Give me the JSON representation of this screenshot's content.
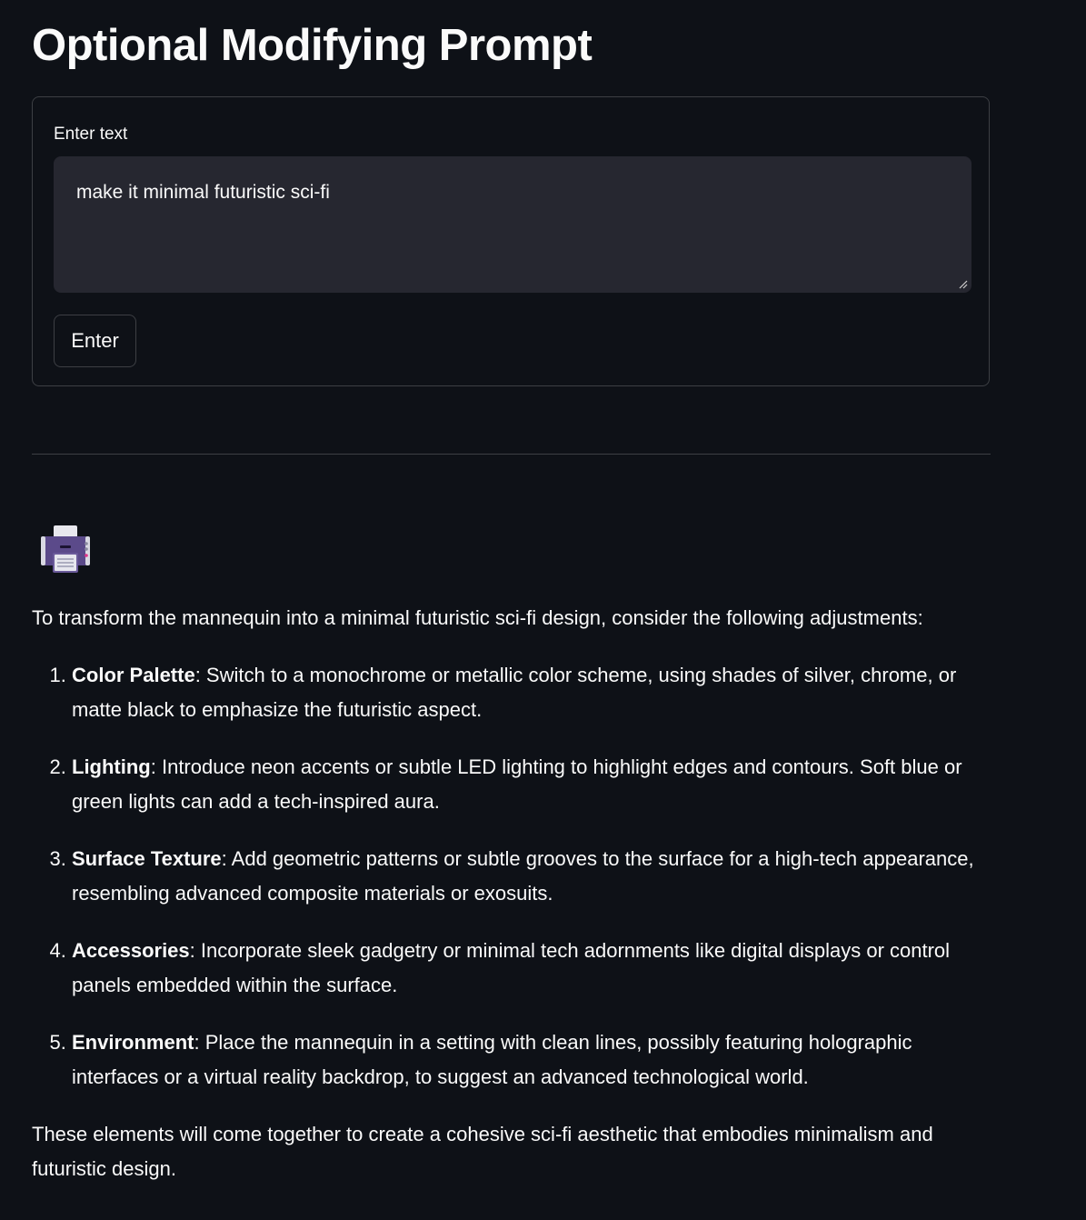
{
  "page": {
    "title": "Optional Modifying Prompt"
  },
  "form": {
    "field_label": "Enter text",
    "text_value": "make it minimal futuristic sci-fi",
    "submit_label": "Enter"
  },
  "response": {
    "avatar_icon": "printer-icon",
    "intro": "To transform the mannequin into a minimal futuristic sci-fi design, consider the following adjustments:",
    "items": [
      {
        "term": "Color Palette",
        "text": ": Switch to a monochrome or metallic color scheme, using shades of silver, chrome, or matte black to emphasize the futuristic aspect."
      },
      {
        "term": "Lighting",
        "text": ": Introduce neon accents or subtle LED lighting to highlight edges and contours. Soft blue or green lights can add a tech-inspired aura."
      },
      {
        "term": "Surface Texture",
        "text": ": Add geometric patterns or subtle grooves to the surface for a high-tech appearance, resembling advanced composite materials or exosuits."
      },
      {
        "term": "Accessories",
        "text": ": Incorporate sleek gadgetry or minimal tech adornments like digital displays or control panels embedded within the surface."
      },
      {
        "term": "Environment",
        "text": ": Place the mannequin in a setting with clean lines, possibly featuring holographic interfaces or a virtual reality backdrop, to suggest an advanced technological world."
      }
    ],
    "outro": "These elements will come together to create a cohesive sci-fi aesthetic that embodies minimalism and futuristic design."
  },
  "colors": {
    "background": "#0e1117",
    "input_background": "#262730",
    "text": "#fafafa",
    "avatar_purple": "#5b4a8a"
  }
}
